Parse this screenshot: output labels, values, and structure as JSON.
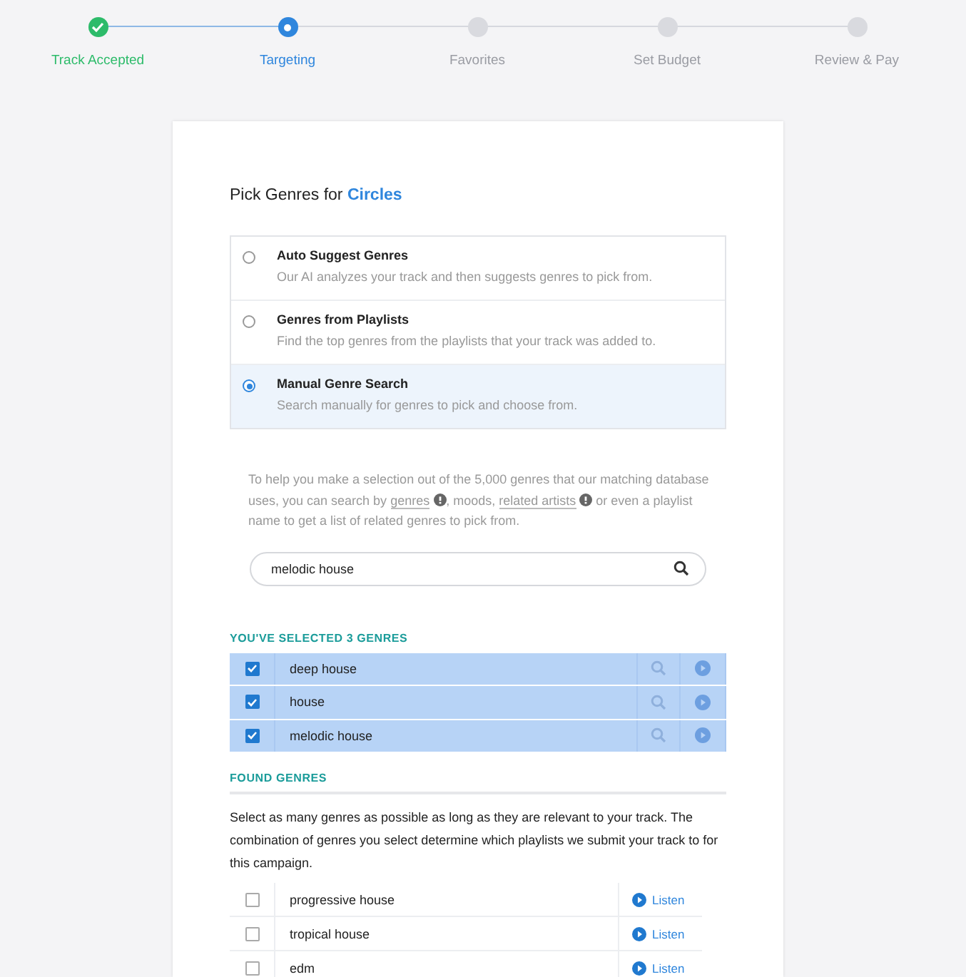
{
  "steps": [
    {
      "label": "Track Accepted",
      "completed": true,
      "selected": false
    },
    {
      "label": "Targeting",
      "completed": false,
      "selected": true
    },
    {
      "label": "Favorites",
      "completed": false,
      "selected": false
    },
    {
      "label": "Set Budget",
      "completed": false,
      "selected": false
    },
    {
      "label": "Review & Pay",
      "completed": false,
      "selected": false
    }
  ],
  "heading": {
    "prefix": "Pick Genres for",
    "track": "Circles"
  },
  "options": [
    {
      "title": "Auto Suggest Genres",
      "description": "Our AI analyzes your track and then suggests genres to pick from.",
      "selected": false
    },
    {
      "title": "Genres from Playlists",
      "description": "Find the top genres from the playlists that your track was added to.",
      "selected": false
    },
    {
      "title": "Manual Genre Search",
      "description": "Search manually for genres to pick and choose from.",
      "selected": true
    }
  ],
  "help_text": {
    "before": "To help you make a selection out of the 5,000 genres that our matching database uses, you can search by",
    "link_1": "genres",
    "middle": ", moods,",
    "link_2": "related artists",
    "after": "or even a playlist name to get a list of related genres to pick from."
  },
  "search": {
    "value": "melodic house"
  },
  "selected_heading": "YOU'VE SELECTED 3 GENRES",
  "selected_genres": [
    {
      "name": "deep house",
      "checked": true
    },
    {
      "name": "house",
      "checked": true
    },
    {
      "name": "melodic house",
      "checked": true
    }
  ],
  "found_heading": "FOUND GENRES",
  "found_text": "Select as many genres as possible as long as they are relevant to your track. The combination of genres you select determine which playlists we submit your track to for this campaign.",
  "found_genres": [
    {
      "name": "progressive house",
      "checked": false,
      "action": "Listen"
    },
    {
      "name": "tropical house",
      "checked": false,
      "action": "Listen"
    },
    {
      "name": "edm",
      "checked": false,
      "action": "Listen"
    }
  ]
}
